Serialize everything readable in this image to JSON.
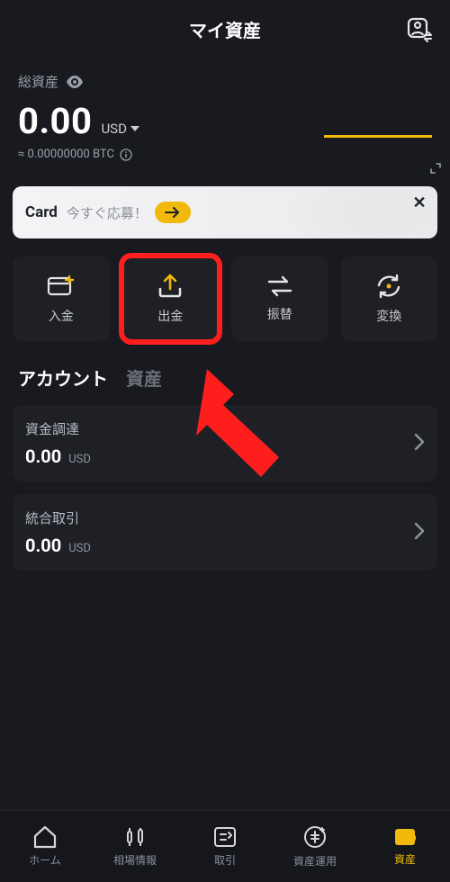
{
  "header": {
    "title": "マイ資産"
  },
  "total": {
    "label": "総資産",
    "amount": "0.00",
    "currency": "USD",
    "btc_line": "≈ 0.00000000 BTC"
  },
  "card_banner": {
    "label": "Card",
    "sub": "今すぐ応募！"
  },
  "actions": [
    {
      "label": "入金"
    },
    {
      "label": "出金"
    },
    {
      "label": "振替"
    },
    {
      "label": "変換"
    }
  ],
  "tabs": {
    "accounts": "アカウント",
    "assets": "資産"
  },
  "accounts": [
    {
      "title": "資金調達",
      "amount": "0.00",
      "ccy": "USD"
    },
    {
      "title": "統合取引",
      "amount": "0.00",
      "ccy": "USD"
    }
  ],
  "nav": [
    {
      "label": "ホーム"
    },
    {
      "label": "相場情報"
    },
    {
      "label": "取引"
    },
    {
      "label": "資産運用"
    },
    {
      "label": "資産"
    }
  ]
}
